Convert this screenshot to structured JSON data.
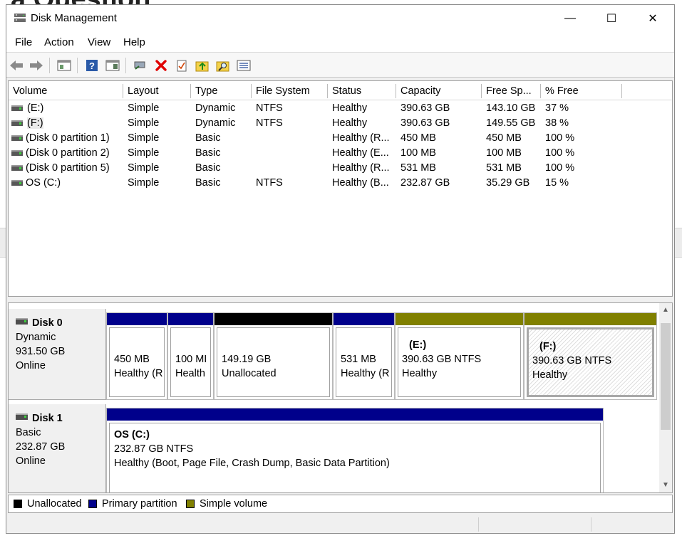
{
  "background": {
    "title_fragment": "a Question"
  },
  "window": {
    "title": "Disk Management",
    "controls": {
      "minimize": "—",
      "maximize": "☐",
      "close": "✕"
    }
  },
  "menu": [
    "File",
    "Action",
    "View",
    "Help"
  ],
  "toolbar_icons": [
    "back-arrow-icon",
    "forward-arrow-icon",
    "console-tree-icon",
    "help-icon",
    "properties-pane-icon",
    "connect-icon",
    "delete-icon",
    "checklist-icon",
    "folder-up-icon",
    "search-folder-icon",
    "list-view-icon"
  ],
  "volume_list": {
    "columns": [
      "Volume",
      "Layout",
      "Type",
      "File System",
      "Status",
      "Capacity",
      "Free Sp...",
      "% Free"
    ],
    "rows": [
      [
        "(E:)",
        "Simple",
        "Dynamic",
        "NTFS",
        "Healthy",
        "390.63 GB",
        "143.10 GB",
        "37 %"
      ],
      [
        "(F:)",
        "Simple",
        "Dynamic",
        "NTFS",
        "Healthy",
        "390.63 GB",
        "149.55 GB",
        "38 %"
      ],
      [
        "(Disk 0 partition 1)",
        "Simple",
        "Basic",
        "",
        "Healthy (R...",
        "450 MB",
        "450 MB",
        "100 %"
      ],
      [
        "(Disk 0 partition 2)",
        "Simple",
        "Basic",
        "",
        "Healthy (E...",
        "100 MB",
        "100 MB",
        "100 %"
      ],
      [
        "(Disk 0 partition 5)",
        "Simple",
        "Basic",
        "",
        "Healthy (R...",
        "531 MB",
        "531 MB",
        "100 %"
      ],
      [
        "OS (C:)",
        "Simple",
        "Basic",
        "NTFS",
        "Healthy (B...",
        "232.87 GB",
        "35.29 GB",
        "15 %"
      ]
    ]
  },
  "disks": [
    {
      "name": "Disk 0",
      "type": "Dynamic",
      "size": "931.50 GB",
      "state": "Online",
      "partitions": [
        {
          "line1": "",
          "line2": "450 MB",
          "line3": "Healthy (R"
        },
        {
          "line1": "",
          "line2": "100 MI",
          "line3": "Health"
        },
        {
          "line1": "",
          "line2": "149.19 GB",
          "line3": "Unallocated"
        },
        {
          "line1": "",
          "line2": "531 MB",
          "line3": "Healthy (R"
        },
        {
          "line1": "(E:)",
          "line2": "390.63 GB NTFS",
          "line3": "Healthy"
        },
        {
          "line1": "(F:)",
          "line2": "390.63 GB NTFS",
          "line3": "Healthy"
        }
      ]
    },
    {
      "name": "Disk 1",
      "type": "Basic",
      "size": "232.87 GB",
      "state": "Online",
      "partitions": [
        {
          "line1": "OS  (C:)",
          "line2": "232.87 GB NTFS",
          "line3": "Healthy (Boot, Page File, Crash Dump, Basic Data Partition)"
        }
      ]
    }
  ],
  "legend": [
    "Unallocated",
    "Primary partition",
    "Simple volume"
  ],
  "colors": {
    "unallocated": "#000000",
    "primary": "#00008b",
    "simple": "#808000",
    "delete_red": "#e00000"
  }
}
